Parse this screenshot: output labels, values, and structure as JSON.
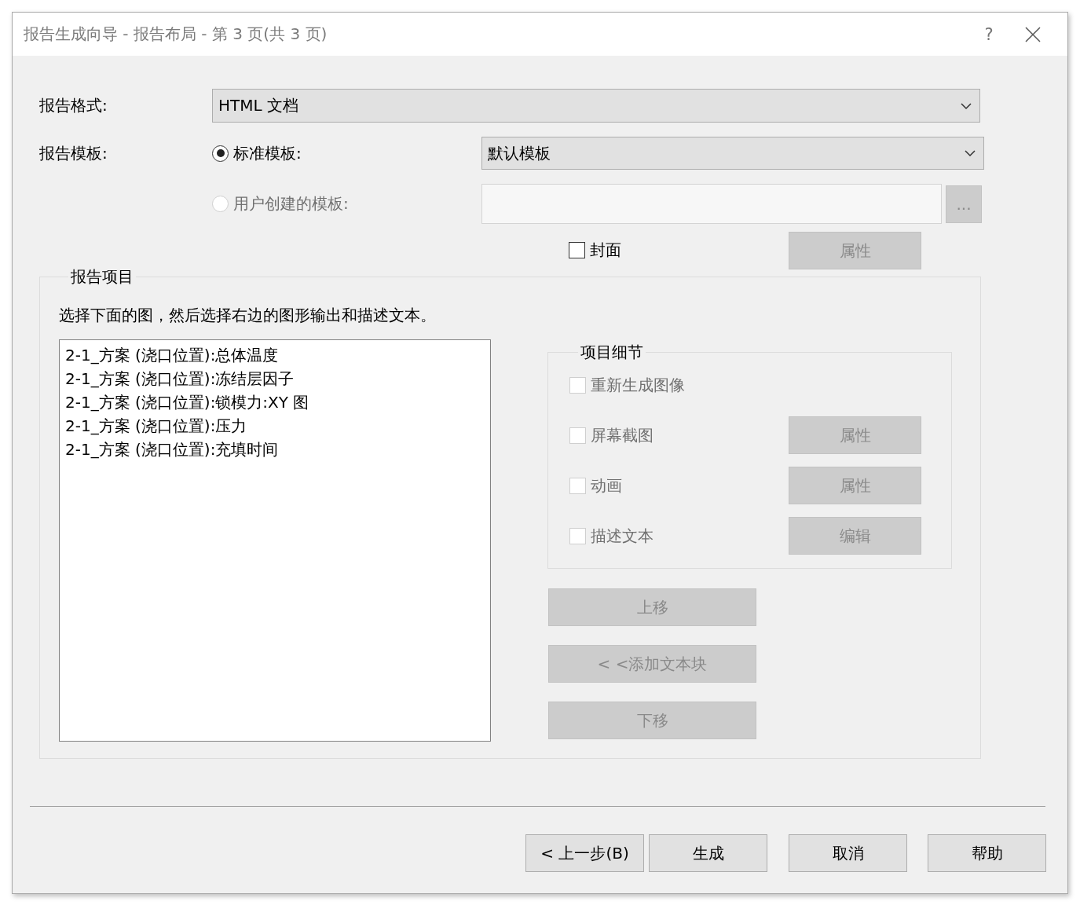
{
  "window": {
    "title": "报告生成向导 - 报告布局 - 第 3 页(共 3 页)",
    "help": "?"
  },
  "format": {
    "label": "报告格式:",
    "value": "HTML 文档"
  },
  "template": {
    "label": "报告模板:",
    "standard_value": "默认模板",
    "options": [
      {
        "label": "标准模板:",
        "selected": true,
        "disabled": false
      },
      {
        "label": "用户创建的模板:",
        "selected": false,
        "disabled": true
      }
    ],
    "browse_button": {
      "label": "...",
      "disabled": true
    }
  },
  "cover": {
    "label": "封面",
    "checked": false,
    "disabled": false
  },
  "cover_properties": {
    "label": "属性",
    "disabled": true
  },
  "report_items": {
    "legend": "报告项目",
    "instruction": "选择下面的图，然后选择右边的图形输出和描述文本。",
    "list": [
      {
        "label": "2-1_方案 (浇口位置):总体温度",
        "selected": false
      },
      {
        "label": "2-1_方案 (浇口位置):冻结层因子",
        "selected": false
      },
      {
        "label": "2-1_方案 (浇口位置):锁模力:XY 图",
        "selected": false
      },
      {
        "label": "2-1_方案 (浇口位置):压力",
        "selected": false
      },
      {
        "label": "2-1_方案 (浇口位置):充填时间",
        "selected": false
      }
    ],
    "details": {
      "legend": "项目细节",
      "options": [
        {
          "label": "重新生成图像",
          "checked": false,
          "disabled": true
        },
        {
          "label": "屏幕截图",
          "checked": false,
          "disabled": true,
          "button": {
            "label": "属性",
            "disabled": true
          }
        },
        {
          "label": "动画",
          "checked": false,
          "disabled": true,
          "button": {
            "label": "属性",
            "disabled": true
          }
        },
        {
          "label": "描述文本",
          "checked": false,
          "disabled": true,
          "button": {
            "label": "编辑",
            "disabled": true
          }
        }
      ]
    },
    "actions": [
      {
        "label": "上移",
        "disabled": true
      },
      {
        "label": "< <添加文本块",
        "disabled": true
      },
      {
        "label": "下移",
        "disabled": true
      }
    ]
  },
  "buttons": [
    {
      "label": "< 上一步(B)",
      "disabled": false
    },
    {
      "label": "生成",
      "disabled": false
    },
    {
      "label": "取消",
      "disabled": false
    },
    {
      "label": "帮助",
      "disabled": false
    }
  ]
}
